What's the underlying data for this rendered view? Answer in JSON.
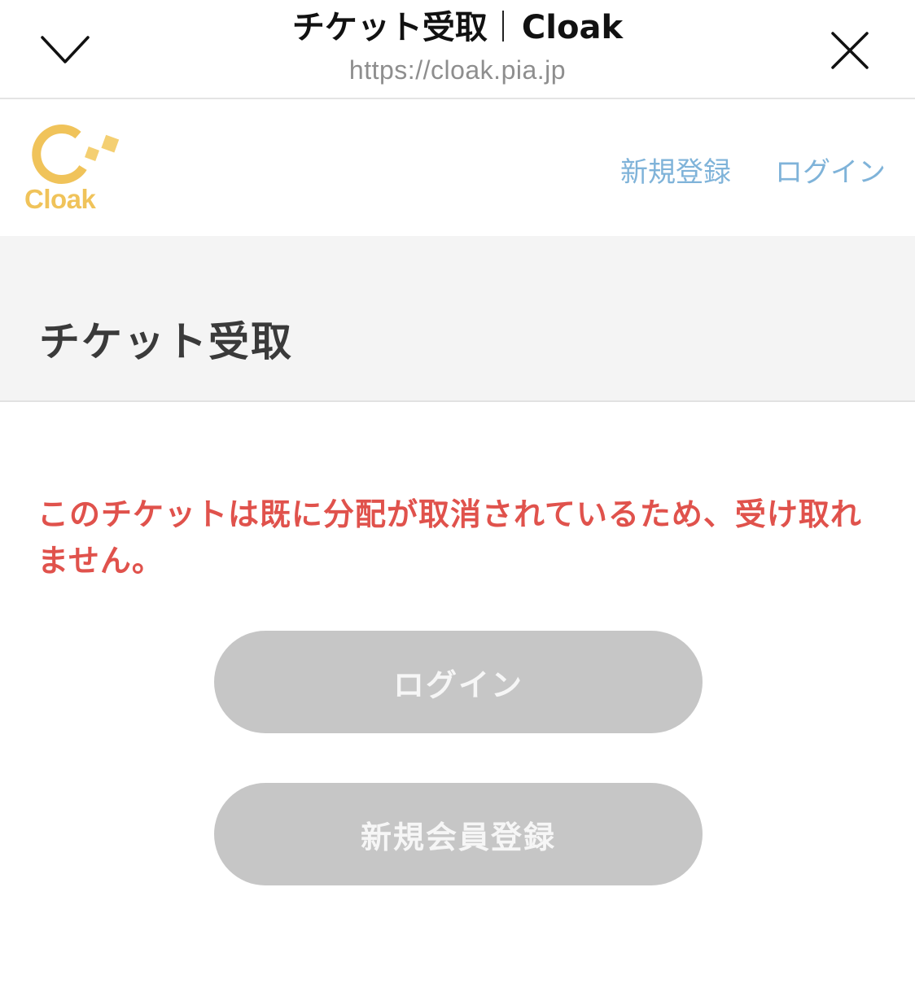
{
  "browser": {
    "title_ja": "チケット受取",
    "title_brand": "Cloak",
    "url": "https://cloak.pia.jp",
    "collapse_icon": "chevron-down-icon",
    "close_icon": "close-icon"
  },
  "site_header": {
    "logo_text": "Cloak",
    "logo_color": "#f0c35a",
    "nav": {
      "register": "新規登録",
      "login": "ログイン"
    },
    "link_color": "#7fb3d9"
  },
  "page": {
    "title": "チケット受取",
    "error_message": "このチケットは既に分配が取消されているため、受け取れません。",
    "error_color": "#e0524c"
  },
  "actions": {
    "login_label": "ログイン",
    "register_label": "新規会員登録",
    "button_color": "#c6c6c6"
  }
}
